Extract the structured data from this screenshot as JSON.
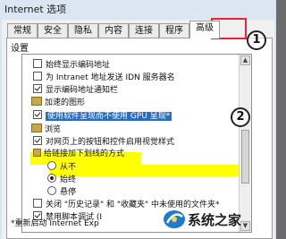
{
  "window": {
    "title": "Internet 选项"
  },
  "tabs": [
    {
      "label": "常规"
    },
    {
      "label": "安全"
    },
    {
      "label": "隐私"
    },
    {
      "label": "内容"
    },
    {
      "label": "连接"
    },
    {
      "label": "程序"
    },
    {
      "label": "高级",
      "active": true
    }
  ],
  "settings": {
    "label": "设置",
    "items": [
      {
        "label": "始终显示编码地址",
        "type": "checkbox",
        "checked": false
      },
      {
        "label": "为 Intranet 地址发送 IDN 服务器名",
        "type": "checkbox",
        "checked": false
      },
      {
        "label": "显示编码地址通知栏",
        "type": "checkbox",
        "checked": true
      },
      {
        "label": "加速的图形",
        "type": "group"
      },
      {
        "label": "使用软件呈现而不使用 GPU 呈现*",
        "type": "checkbox",
        "checked": true,
        "selected": true
      },
      {
        "label": "浏览",
        "type": "group"
      },
      {
        "label": "对网页上的按钮和控件启用视觉样式",
        "type": "checkbox",
        "checked": true
      },
      {
        "label": "给链接加下划线的方式",
        "type": "group-sub"
      },
      {
        "label": "从不",
        "type": "radio",
        "checked": false
      },
      {
        "label": "始终",
        "type": "radio",
        "checked": true
      },
      {
        "label": "悬停",
        "type": "radio",
        "checked": false
      },
      {
        "label": "关闭 \"历史记录\" 和 \"收藏夹\" 中未使用的文件夹*",
        "type": "checkbox",
        "checked": false
      },
      {
        "label": "禁用脚本调试 (I",
        "type": "checkbox",
        "checked": true
      }
    ]
  },
  "footnote": "*重新启动 Internet Exp",
  "callouts": {
    "one": "1",
    "two": "2"
  },
  "watermark": {
    "text": "系统之家"
  },
  "colors": {
    "highlight": "#ffff00",
    "callout_border": "#e23",
    "selection": "#2a6cc4"
  }
}
